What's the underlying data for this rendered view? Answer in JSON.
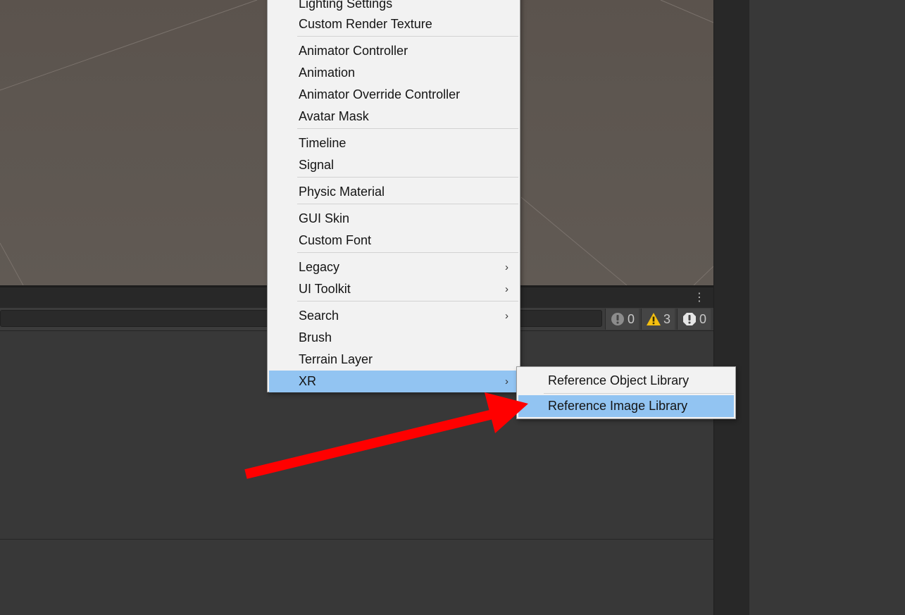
{
  "context_menu": {
    "items": [
      {
        "label": "Lighting Settings"
      },
      {
        "label": "Custom Render Texture"
      },
      {
        "label": "Animator Controller"
      },
      {
        "label": "Animation"
      },
      {
        "label": "Animator Override Controller"
      },
      {
        "label": "Avatar Mask"
      },
      {
        "label": "Timeline"
      },
      {
        "label": "Signal"
      },
      {
        "label": "Physic Material"
      },
      {
        "label": "GUI Skin"
      },
      {
        "label": "Custom Font"
      },
      {
        "label": "Legacy"
      },
      {
        "label": "UI Toolkit"
      },
      {
        "label": "Search"
      },
      {
        "label": "Brush"
      },
      {
        "label": "Terrain Layer"
      },
      {
        "label": "XR"
      }
    ],
    "submenu_chevron": "›"
  },
  "xr_submenu": {
    "items": [
      {
        "label": "Reference Object Library"
      },
      {
        "label": "Reference Image Library"
      }
    ]
  },
  "console": {
    "menu_icon": "⋮",
    "info_count": "0",
    "warning_count": "3",
    "error_count": "0"
  },
  "colors": {
    "menu_highlight": "#92c4f2",
    "annotation_arrow": "#ff0000",
    "warning_icon": "#f4bf10"
  }
}
